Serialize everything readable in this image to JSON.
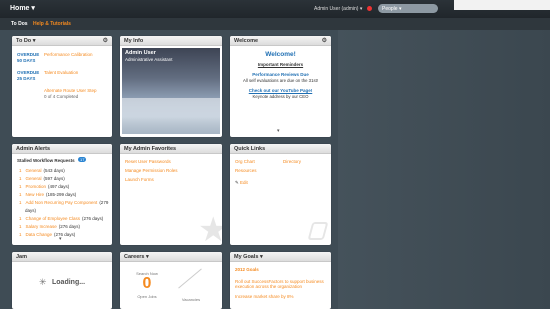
{
  "topbar": {
    "home_label": "Home ▾",
    "admin_label": "Admin User (admin) ▾",
    "people_label": "People ▾"
  },
  "subnav": {
    "todos": "To Dos",
    "help": "Help & Tutorials"
  },
  "todo": {
    "title": "To Do ▾",
    "items": [
      {
        "status": "OVERDUE",
        "days": "50 DAYS",
        "label": "Performance Calibration"
      },
      {
        "status": "OVERDUE",
        "days": "25 DAYS",
        "label": "Talent Evaluation"
      }
    ],
    "route": "Alternate Route User Step",
    "route_sub": "0 of 4 Completed"
  },
  "myinfo": {
    "title": "My Info",
    "name": "Admin User",
    "role": "Administrative Assistant"
  },
  "welcome": {
    "title": "Welcome",
    "heading": "Welcome!",
    "reminders": "Important Reminders",
    "review_title": "Performance Reviews Due",
    "review_sub": "All self evaluations are due on the 31st!",
    "youtube_title": "Check out our YouTube Page!",
    "youtube_sub": "Keynote address by our CEO"
  },
  "alerts": {
    "title": "Admin Alerts",
    "stalled": "Stalled Workflow Requests",
    "count": "17",
    "items": [
      {
        "num": "1",
        "label": "General",
        "days": "(543 days)"
      },
      {
        "num": "1",
        "label": "General",
        "days": "(597 days)"
      },
      {
        "num": "1",
        "label": "Promotion",
        "days": "(497 days)"
      },
      {
        "num": "1",
        "label": "New Hire",
        "days": "(185-299 days)"
      },
      {
        "num": "1",
        "label": "Add Non Recurring Pay Component",
        "days": "(279"
      },
      {
        "num": "",
        "label": "",
        "days": "days)"
      },
      {
        "num": "1",
        "label": "Change of Employee Class",
        "days": "(276 days)"
      },
      {
        "num": "1",
        "label": "Salary Increase",
        "days": "(276 days)"
      },
      {
        "num": "1",
        "label": "Data Change",
        "days": "(276 days)"
      }
    ]
  },
  "favorites": {
    "title": "My Admin Favorites",
    "links": [
      "Reset User Passwords",
      "Manage Permission Roles",
      "Launch Forms"
    ]
  },
  "quicklinks": {
    "title": "Quick Links",
    "col1": [
      "Org Chart",
      "Resources"
    ],
    "col2": [
      "Directory"
    ],
    "edit": "Edit"
  },
  "jam": {
    "title": "Jam",
    "loading": "Loading..."
  },
  "careers": {
    "title": "Careers ▾",
    "search_label": "Search Now",
    "value": "0",
    "open_jobs": "Open Jobs",
    "vacancies": "Vacancies"
  },
  "goals": {
    "title": "My Goals ▾",
    "header": "2012 Goals",
    "items": [
      "Roll out SuccessFactors to support business execution across the organization",
      "Increase market share by 8%"
    ]
  }
}
